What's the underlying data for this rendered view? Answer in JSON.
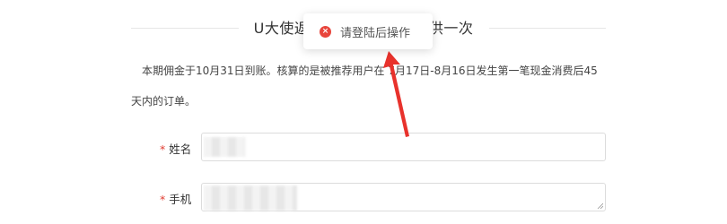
{
  "section": {
    "title": "U大使返佣                  提供一次"
  },
  "notice": {
    "text": "本期佣金于10月31日到账。核算的是被推荐用户在  7月17日-8月16日发生第一笔现金消费后45天内的订单。"
  },
  "form": {
    "required_mark": "*",
    "name_label": "姓名",
    "phone_label": "手机"
  },
  "toast": {
    "message": "请登陆后操作",
    "icon": "error-icon"
  },
  "colors": {
    "required": "#e03c31",
    "toast_icon": "#e8453c",
    "arrow": "#e8322c"
  }
}
